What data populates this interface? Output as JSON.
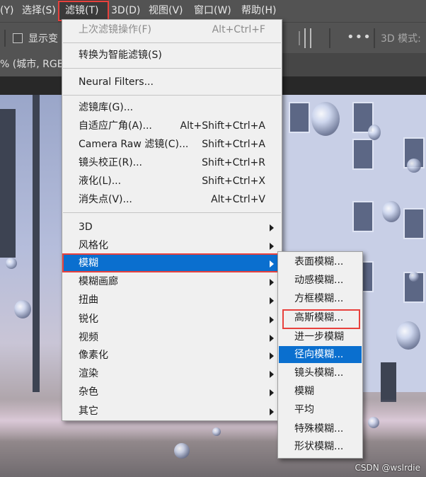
{
  "menubar": {
    "items": [
      {
        "label": "(Y)"
      },
      {
        "label": "选择(S)"
      },
      {
        "label": "滤镜(T)"
      },
      {
        "label": "3D(D)"
      },
      {
        "label": "视图(V)"
      },
      {
        "label": "窗口(W)"
      },
      {
        "label": "帮助(H)"
      }
    ]
  },
  "options_bar": {
    "show_transform_label": "显示变",
    "mode_label": "3D 模式:"
  },
  "document_tab": {
    "label": "% (城市, RGB/"
  },
  "filter_menu": {
    "last_filter": {
      "label": "上次滤镜操作(F)",
      "shortcut": "Alt+Ctrl+F"
    },
    "smart_filter": {
      "label": "转换为智能滤镜(S)"
    },
    "neural": {
      "label": "Neural Filters..."
    },
    "gallery": {
      "label": "滤镜库(G)..."
    },
    "adaptive_wide": {
      "label": "自适应广角(A)...",
      "shortcut": "Alt+Shift+Ctrl+A"
    },
    "camera_raw": {
      "label": "Camera Raw 滤镜(C)...",
      "shortcut": "Shift+Ctrl+A"
    },
    "lens_correction": {
      "label": "镜头校正(R)...",
      "shortcut": "Shift+Ctrl+R"
    },
    "liquify": {
      "label": "液化(L)...",
      "shortcut": "Shift+Ctrl+X"
    },
    "vanishing_point": {
      "label": "消失点(V)...",
      "shortcut": "Alt+Ctrl+V"
    },
    "submenus": [
      {
        "label": "3D"
      },
      {
        "label": "风格化"
      },
      {
        "label": "模糊"
      },
      {
        "label": "模糊画廊"
      },
      {
        "label": "扭曲"
      },
      {
        "label": "锐化"
      },
      {
        "label": "视频"
      },
      {
        "label": "像素化"
      },
      {
        "label": "渲染"
      },
      {
        "label": "杂色"
      },
      {
        "label": "其它"
      }
    ]
  },
  "blur_submenu": {
    "items": [
      {
        "label": "表面模糊..."
      },
      {
        "label": "动感模糊..."
      },
      {
        "label": "方框模糊..."
      },
      {
        "label": "高斯模糊..."
      },
      {
        "label": "进一步模糊"
      },
      {
        "label": "径向模糊..."
      },
      {
        "label": "镜头模糊..."
      },
      {
        "label": "模糊"
      },
      {
        "label": "平均"
      },
      {
        "label": "特殊模糊..."
      },
      {
        "label": "形状模糊..."
      }
    ]
  },
  "watermark": "CSDN @wslrdie",
  "colors": {
    "highlight": "#0a6fcf",
    "annotation_red": "#e8413d",
    "menu_bg": "#f0f0f0",
    "chrome": "#535353"
  }
}
